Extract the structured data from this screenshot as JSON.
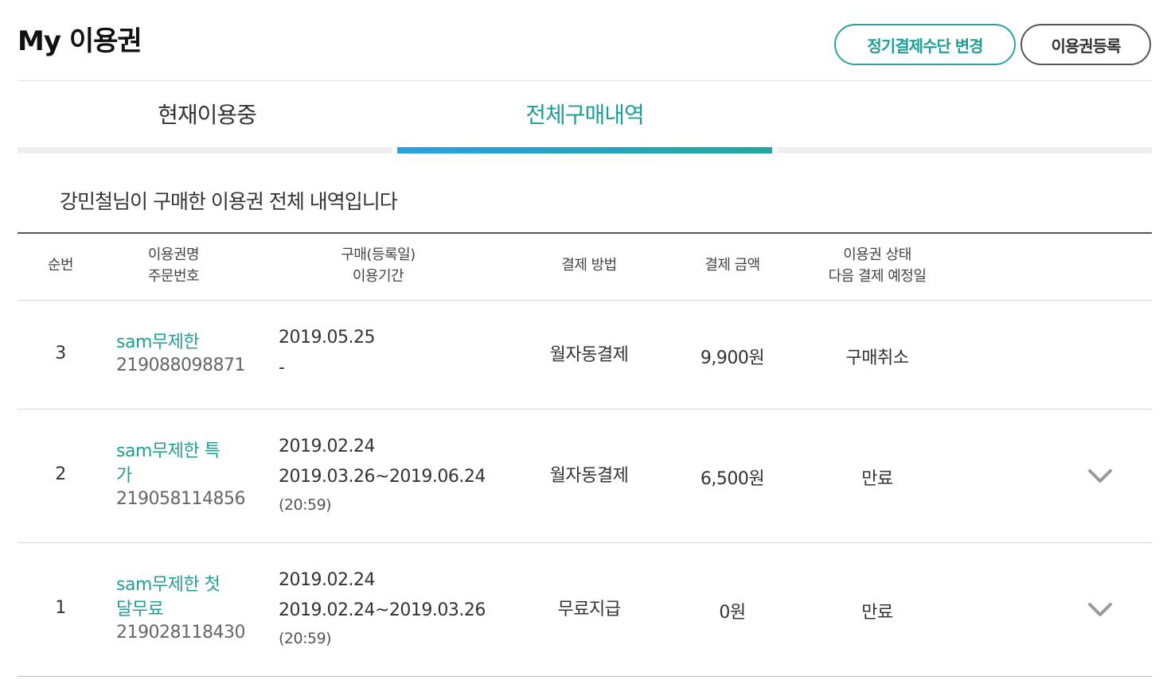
{
  "header": {
    "title": "My 이용권",
    "payment_button": "정기결제수단 변경",
    "register_button": "이용권등록"
  },
  "tabs": [
    {
      "label": "현재이용중",
      "active": false
    },
    {
      "label": "전체구매내역",
      "active": true
    }
  ],
  "summary": "강민철님이 구매한 이용권 전체 내역입니다",
  "table": {
    "headers": {
      "seq": "순번",
      "name_line1": "이용권명",
      "name_line2": "주문번호",
      "date_line1": "구매(등록일)",
      "date_line2": "이용기간",
      "method": "결제 방법",
      "amount": "결제 금액",
      "status_line1": "이용권 상태",
      "status_line2": "다음 결제 예정일"
    },
    "rows": [
      {
        "seq": "3",
        "name_line1": "sam무제한",
        "name_line2": "",
        "order_no": "219088098871",
        "purchase_date": "2019.05.25",
        "period": "-",
        "period_time": "",
        "method": "월자동결제",
        "amount": "9,900원",
        "status": "구매취소",
        "expandable": false
      },
      {
        "seq": "2",
        "name_line1": "sam무제한 특",
        "name_line2": "가",
        "order_no": "219058114856",
        "purchase_date": "2019.02.24",
        "period": "2019.03.26~2019.06.24",
        "period_time": "(20:59)",
        "method": "월자동결제",
        "amount": "6,500원",
        "status": "만료",
        "expandable": true
      },
      {
        "seq": "1",
        "name_line1": "sam무제한 첫",
        "name_line2": "달무료",
        "order_no": "219028118430",
        "purchase_date": "2019.02.24",
        "period": "2019.02.24~2019.03.26",
        "period_time": "(20:59)",
        "method": "무료지급",
        "amount": "0원",
        "status": "만료",
        "expandable": true
      }
    ]
  },
  "colors": {
    "accent": "#1f9e96",
    "tab_gradient_start": "#2ba0e0",
    "tab_gradient_end": "#24a7a0"
  },
  "icons": {
    "expand": "chevron-down-icon"
  }
}
